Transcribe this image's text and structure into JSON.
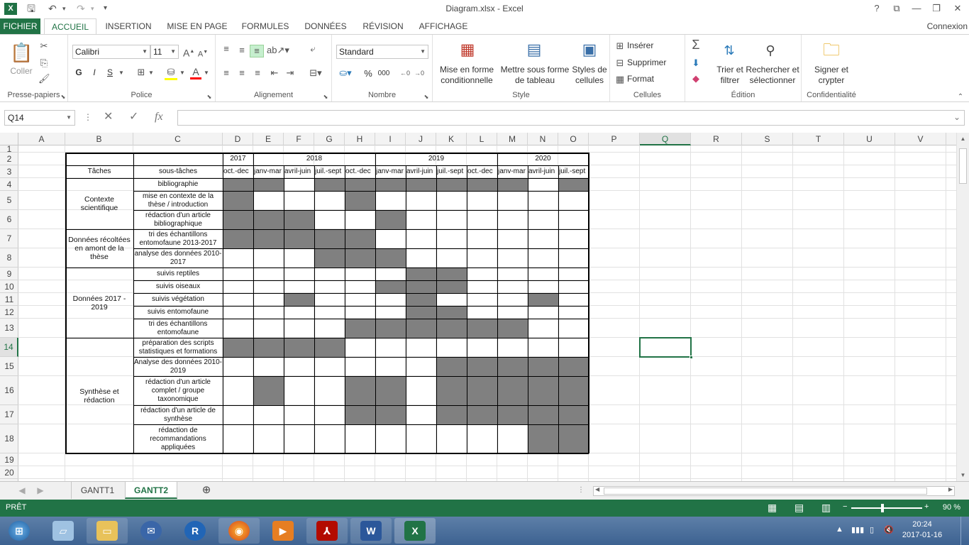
{
  "window": {
    "title": "Diagram.xlsx - Excel",
    "help": "?",
    "minimize": "—",
    "restore": "❐",
    "close": "✕",
    "app_icon": "X"
  },
  "ribbon_tabs": [
    "FICHIER",
    "ACCUEIL",
    "INSERTION",
    "MISE EN PAGE",
    "FORMULES",
    "DONNÉES",
    "RÉVISION",
    "AFFICHAGE"
  ],
  "account": "Connexion",
  "ribbon": {
    "clipboard": {
      "paste": "Coller",
      "label": "Presse-papiers"
    },
    "font": {
      "name": "Calibri",
      "size": "11",
      "bold": "G",
      "italic": "I",
      "underline": "S",
      "label": "Police"
    },
    "alignment": {
      "label": "Alignement"
    },
    "number": {
      "format": "Standard",
      "percent": "%",
      "thousands": "000",
      "label": "Nombre"
    },
    "style": {
      "conditional": "Mise en forme conditionnelle",
      "table": "Mettre sous forme de tableau",
      "cell_styles": "Styles de cellules",
      "label": "Style"
    },
    "cells": {
      "insert": "Insérer",
      "delete": "Supprimer",
      "format": "Format",
      "label": "Cellules"
    },
    "editing": {
      "sort": "Trier et filtrer",
      "find": "Rechercher et sélectionner",
      "label": "Édition"
    },
    "privacy": {
      "sign": "Signer et crypter",
      "label": "Confidentialité"
    }
  },
  "formula_bar": {
    "name_box": "Q14",
    "fx": "fx",
    "content": ""
  },
  "columns": [
    "A",
    "B",
    "C",
    "D",
    "E",
    "F",
    "G",
    "H",
    "I",
    "J",
    "K",
    "L",
    "M",
    "N",
    "O",
    "P",
    "Q",
    "R",
    "S",
    "T",
    "U",
    "V"
  ],
  "rows": [
    "1",
    "2",
    "3",
    "4",
    "5",
    "6",
    "7",
    "8",
    "9",
    "10",
    "11",
    "12",
    "13",
    "14",
    "15",
    "16",
    "17",
    "18",
    "19",
    "20"
  ],
  "selected_cell": {
    "col": "Q",
    "row": "14"
  },
  "gantt": {
    "years": [
      {
        "label": "2017",
        "from": 0,
        "span": 1
      },
      {
        "label": "2018",
        "from": 1,
        "span": 4
      },
      {
        "label": "2019",
        "from": 5,
        "span": 4
      },
      {
        "label": "2020",
        "from": 9,
        "span": 3
      }
    ],
    "header_tasks": "Tâches",
    "header_subtasks": "sous-tâches",
    "periods": [
      "oct.-dec",
      "janv-mar",
      "avril-juin",
      "juil.-sept",
      "oct.-dec",
      "janv-mar",
      "avril-juin",
      "juil.-sept",
      "oct.-dec",
      "janv-mar",
      "avril-juin",
      "juil.-sept"
    ],
    "task_groups": [
      {
        "label": "Contexte scientifique",
        "first_row": 0,
        "row_count": 3
      },
      {
        "label": "Données récoltées en amont de la thèse",
        "first_row": 3,
        "row_count": 2
      },
      {
        "label": "Données 2017 - 2019",
        "first_row": 5,
        "row_count": 5
      },
      {
        "label": "Synthèse et rédaction",
        "first_row": 10,
        "row_count": 5
      }
    ],
    "subtasks": [
      {
        "label": "bibliographie",
        "filled": [
          0,
          1,
          3,
          4,
          5,
          6,
          7,
          8,
          9,
          11
        ]
      },
      {
        "label": "mise en contexte de la thèse / introduction",
        "filled": [
          0,
          4
        ]
      },
      {
        "label": "rédaction d'un article bibliographique",
        "filled": [
          0,
          1,
          2,
          5
        ]
      },
      {
        "label": "tri des échantillons entomofaune 2013-2017",
        "filled": [
          0,
          1,
          2,
          3,
          4
        ]
      },
      {
        "label": "analyse des données 2010-2017",
        "filled": [
          3,
          4,
          5
        ]
      },
      {
        "label": "suivis reptiles",
        "filled": [
          6,
          7
        ]
      },
      {
        "label": "suivis oiseaux",
        "filled": [
          5,
          6,
          7
        ]
      },
      {
        "label": "suivis végétation",
        "filled": [
          2,
          6,
          10
        ]
      },
      {
        "label": "suivis entomofaune",
        "filled": [
          6,
          7
        ]
      },
      {
        "label": "tri des échantillons entomofaune",
        "filled": [
          4,
          5,
          6,
          7,
          8,
          9
        ]
      },
      {
        "label": "préparation des scripts statistiques et formations",
        "filled": [
          0,
          1,
          2,
          3
        ]
      },
      {
        "label": "Analyse des données 2010-2019",
        "filled": [
          7,
          8,
          9,
          10,
          11
        ]
      },
      {
        "label": "rédaction d'un article complet / groupe taxonomique",
        "filled": [
          1,
          4,
          5,
          7,
          8,
          9,
          10,
          11
        ]
      },
      {
        "label": "rédaction d'un article de synthèse",
        "filled": [
          4,
          5,
          7,
          8,
          9,
          10,
          11
        ]
      },
      {
        "label": "rédaction de recommandations appliquées",
        "filled": [
          10,
          11
        ]
      }
    ]
  },
  "sheet_tabs": [
    "GANTT1",
    "GANTT2"
  ],
  "active_sheet": "GANTT2",
  "status": {
    "ready": "PRÊT",
    "zoom": "90 %"
  },
  "taskbar": {
    "time": "20:24",
    "date": "2017-01-16"
  },
  "colors": {
    "excel_green": "#217346",
    "shade": "#808080",
    "grid": "#e1e1e1"
  }
}
